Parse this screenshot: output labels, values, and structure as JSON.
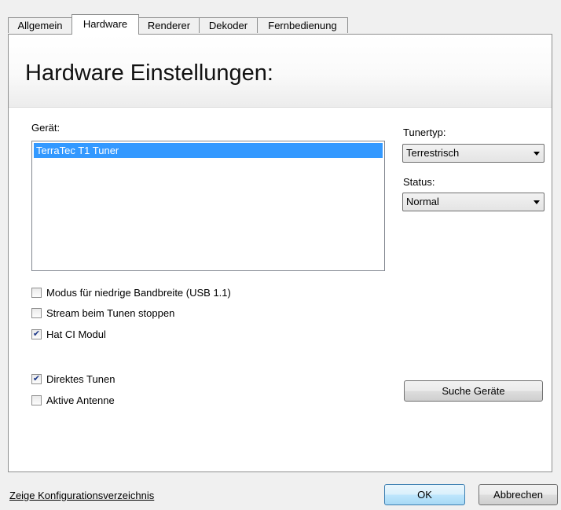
{
  "tabs": [
    {
      "label": "Allgemein",
      "active": false
    },
    {
      "label": "Hardware",
      "active": true
    },
    {
      "label": "Renderer",
      "active": false
    },
    {
      "label": "Dekoder",
      "active": false
    },
    {
      "label": "Fernbedienung",
      "active": false
    }
  ],
  "header": {
    "title": "Hardware Einstellungen:"
  },
  "device": {
    "label": "Gerät:",
    "items": [
      "TerraTec T1 Tuner"
    ],
    "selected_index": 0
  },
  "tuner_type": {
    "label": "Tunertyp:",
    "value": "Terrestrisch"
  },
  "status": {
    "label": "Status:",
    "value": "Normal"
  },
  "options": [
    {
      "label": "Modus für niedrige Bandbreite (USB 1.1)",
      "checked": false
    },
    {
      "label": "Stream beim Tunen stoppen",
      "checked": false
    },
    {
      "label": "Hat CI Modul",
      "checked": true
    },
    {
      "label": "Direktes Tunen",
      "checked": true
    },
    {
      "label": "Aktive Antenne",
      "checked": false
    }
  ],
  "buttons": {
    "search_devices": "Suche Geräte",
    "ok": "OK",
    "cancel": "Abbrechen"
  },
  "footer": {
    "config_link": "Zeige Konfigurationsverzeichnis"
  },
  "colors": {
    "selection": "#3399ff",
    "check": "#1f3a8a"
  }
}
